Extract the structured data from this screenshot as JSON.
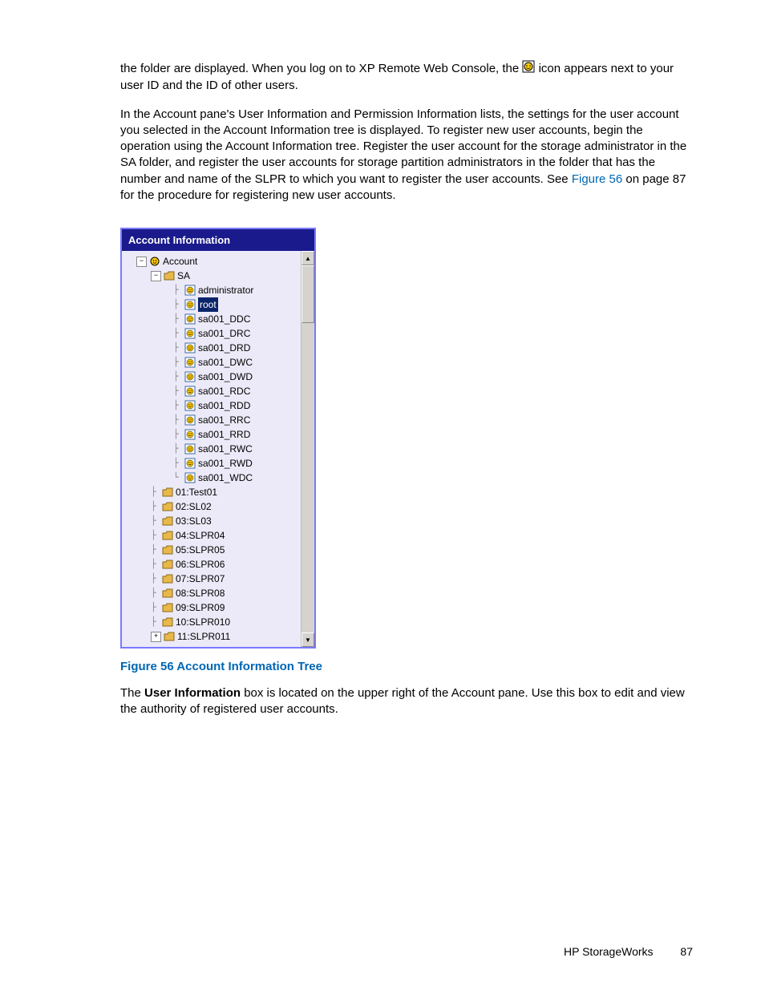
{
  "paragraph1_a": "the folder are displayed. When you log on to XP Remote Web Console, the ",
  "paragraph1_b": "icon appears next to your user ID and the ID of other users.",
  "paragraph2_a": "In the Account pane's User Information and Permission Information lists, the settings for the user account you selected in the Account Information tree is displayed. To register new user accounts, begin the operation using the Account Information tree. Register the user account for the storage administrator in the SA folder, and register the user accounts for storage partition administrators in the folder that has the number and name of the SLPR to which you want to register the user accounts. See ",
  "paragraph2_link": "Figure 56",
  "paragraph2_b": " on page 87 for the procedure for registering new user accounts.",
  "panel": {
    "title": "Account Information",
    "root": {
      "label": "Account",
      "toggle": "−"
    },
    "sa": {
      "label": "SA",
      "toggle": "−"
    },
    "users": [
      "administrator",
      "root",
      "sa001_DDC",
      "sa001_DRC",
      "sa001_DRD",
      "sa001_DWC",
      "sa001_DWD",
      "sa001_RDC",
      "sa001_RDD",
      "sa001_RRC",
      "sa001_RRD",
      "sa001_RWC",
      "sa001_RWD",
      "sa001_WDC"
    ],
    "selected_index": 1,
    "folders": [
      {
        "label": "01:Test01",
        "toggle": ""
      },
      {
        "label": "02:SL02",
        "toggle": ""
      },
      {
        "label": "03:SL03",
        "toggle": ""
      },
      {
        "label": "04:SLPR04",
        "toggle": ""
      },
      {
        "label": "05:SLPR05",
        "toggle": ""
      },
      {
        "label": "06:SLPR06",
        "toggle": ""
      },
      {
        "label": "07:SLPR07",
        "toggle": ""
      },
      {
        "label": "08:SLPR08",
        "toggle": ""
      },
      {
        "label": "09:SLPR09",
        "toggle": ""
      },
      {
        "label": "10:SLPR010",
        "toggle": ""
      },
      {
        "label": "11:SLPR011",
        "toggle": "+"
      }
    ]
  },
  "figure_caption": "Figure 56 Account Information Tree",
  "paragraph3_a": "The ",
  "paragraph3_bold": "User Information",
  "paragraph3_b": " box is located on the upper right of the Account pane. Use this box to edit and view the authority of registered user accounts.",
  "footer_brand": "HP StorageWorks",
  "footer_page": "87"
}
